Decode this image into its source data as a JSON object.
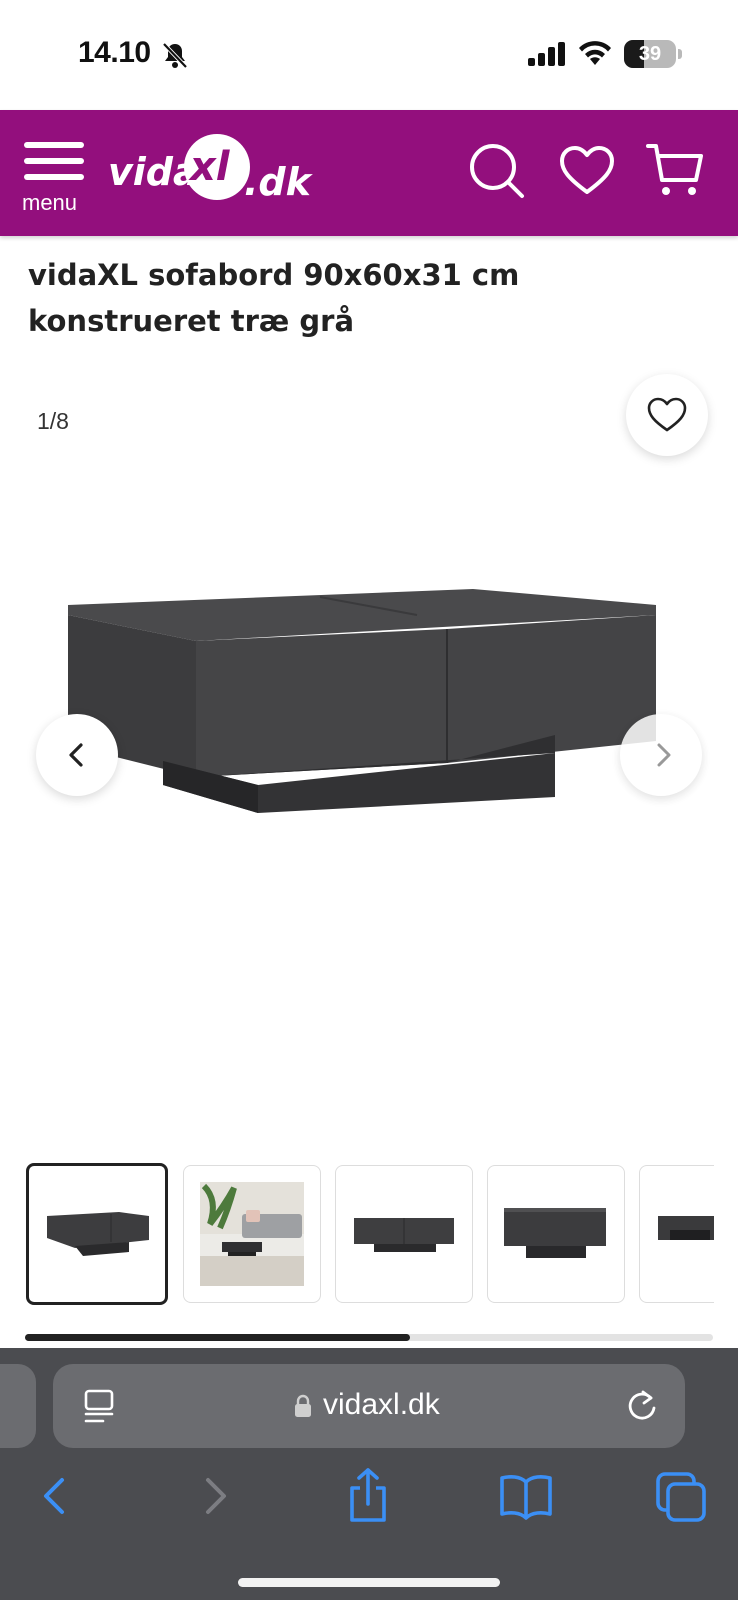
{
  "status_bar": {
    "time": "14.10",
    "battery": "39",
    "battery_level": 0.39
  },
  "header": {
    "menu_label": "menu",
    "logo": {
      "part1": "vida",
      "part2": "xl",
      "part3": ".dk"
    },
    "brand_color": "#930f7d",
    "icons": [
      "search-icon",
      "heart-icon",
      "cart-icon"
    ]
  },
  "product": {
    "title_line1": "vidaXL sofabord 90x60x31 cm",
    "title_line2": "konstrueret træ grå"
  },
  "gallery": {
    "counter": "1/8",
    "active_index": 0,
    "thumbnail_count_visible": 5,
    "scroll_progress": 0.56
  },
  "browser": {
    "url": "vidaxl.dk",
    "toolbar": [
      "back-icon",
      "forward-icon",
      "share-icon",
      "bookmarks-icon",
      "tabs-icon"
    ],
    "accent_color": "#3b8ff5"
  }
}
